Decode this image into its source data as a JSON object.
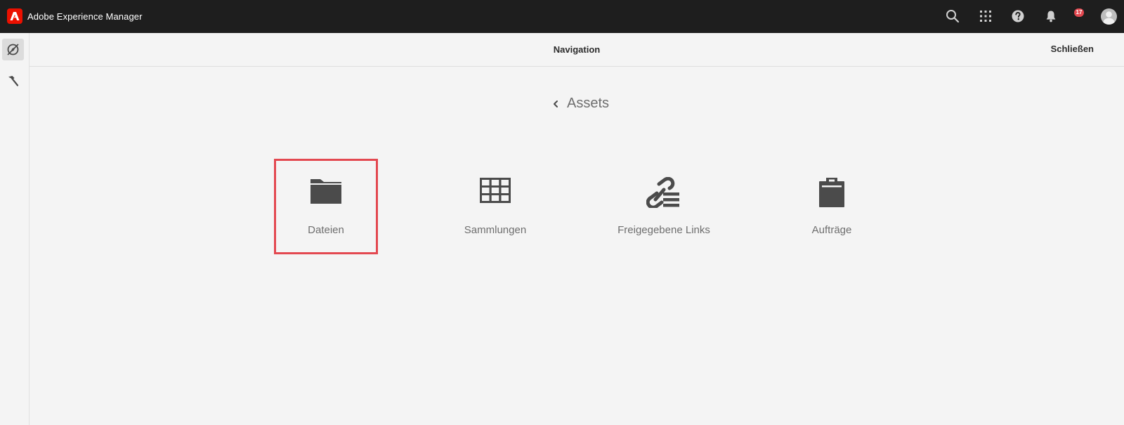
{
  "shell": {
    "brand_name": "Adobe Experience Manager",
    "notification_count": "17",
    "icons": [
      "search-icon",
      "apps-grid-icon",
      "help-icon",
      "bell-icon",
      "user-avatar"
    ]
  },
  "rail": {
    "items": [
      {
        "icon": "navigation-compass-icon",
        "active": true
      },
      {
        "icon": "hammer-icon",
        "active": false
      }
    ]
  },
  "header": {
    "title": "Navigation",
    "close_label": "Schließen"
  },
  "breadcrumb": {
    "label": "Assets",
    "icon": "chevron-left-icon"
  },
  "tiles": [
    {
      "label": "Dateien",
      "icon": "folder-icon",
      "selected": true
    },
    {
      "label": "Sammlungen",
      "icon": "collection-grid-icon",
      "selected": false
    },
    {
      "label": "Freigegebene Links",
      "icon": "shared-links-icon",
      "selected": false
    },
    {
      "label": "Aufträge",
      "icon": "clipboard-icon",
      "selected": false
    }
  ],
  "colors": {
    "shell_bg": "#1e1e1e",
    "brand_red": "#eb1000",
    "page_bg": "#f4f4f4",
    "selection_outline": "#e34850",
    "icon_dark": "#4b4b4b"
  }
}
